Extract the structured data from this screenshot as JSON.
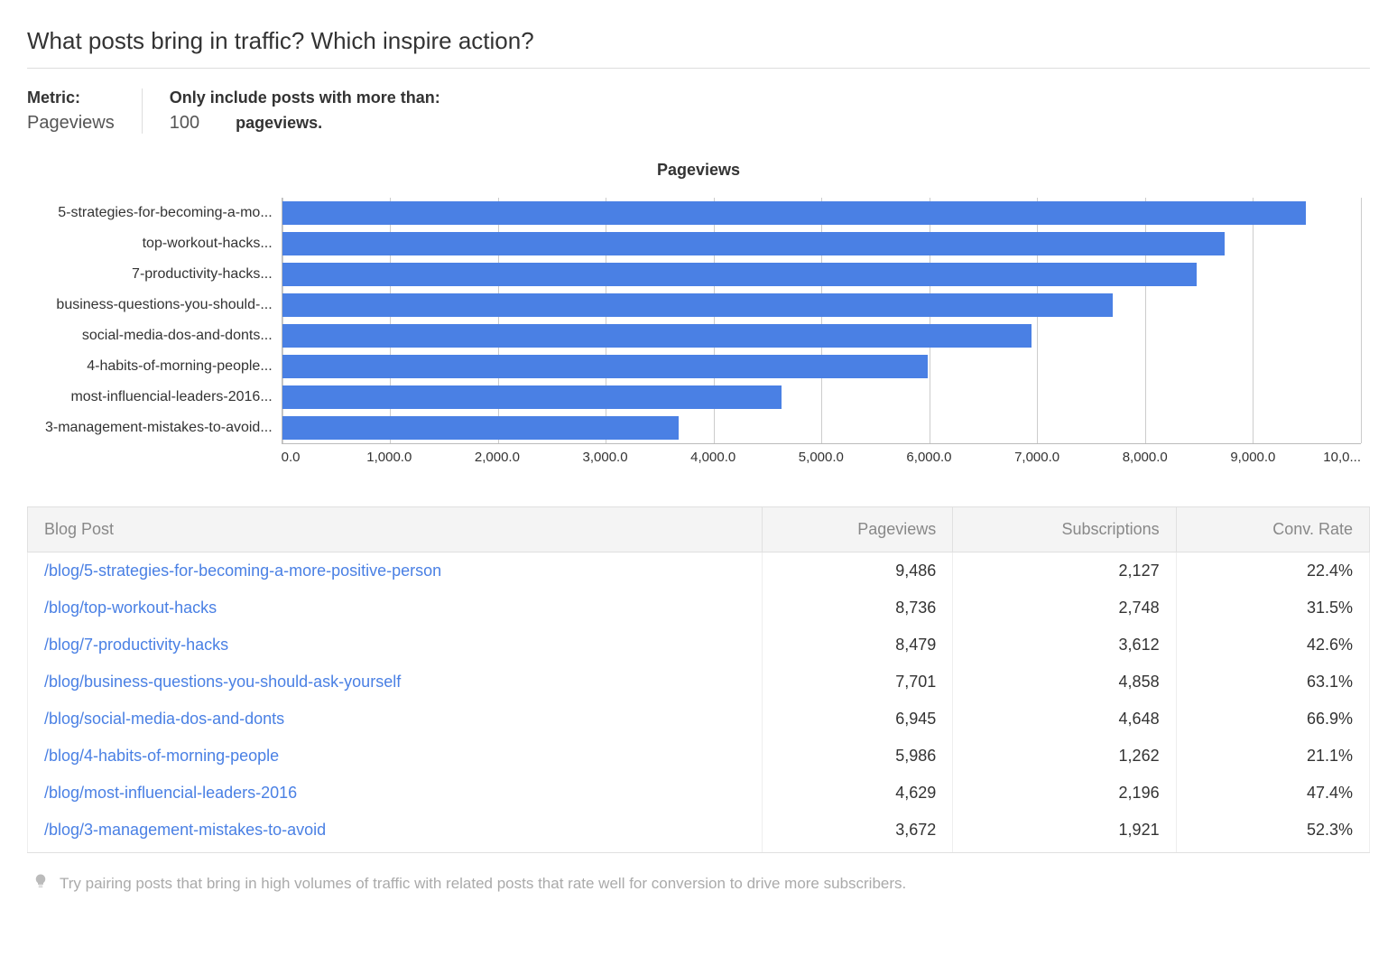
{
  "title": "What posts bring in traffic? Which inspire action?",
  "controls": {
    "metric_label": "Metric:",
    "metric_value": "Pageviews",
    "filter_label": "Only include posts with more than:",
    "filter_value": "100",
    "filter_suffix": "pageviews."
  },
  "chart_data": {
    "type": "bar",
    "orientation": "horizontal",
    "title": "Pageviews",
    "xlabel": "",
    "ylabel": "",
    "xlim": [
      0,
      10000
    ],
    "x_ticks": [
      "0.0",
      "1,000.0",
      "2,000.0",
      "3,000.0",
      "4,000.0",
      "5,000.0",
      "6,000.0",
      "7,000.0",
      "8,000.0",
      "9,000.0",
      "10,0..."
    ],
    "categories": [
      "5-strategies-for-becoming-a-mo...",
      "top-workout-hacks...",
      "7-productivity-hacks...",
      "business-questions-you-should-...",
      "social-media-dos-and-donts...",
      "4-habits-of-morning-people...",
      "most-influencial-leaders-2016...",
      "3-management-mistakes-to-avoid..."
    ],
    "values": [
      9486,
      8736,
      8479,
      7701,
      6945,
      5986,
      4629,
      3672
    ]
  },
  "table": {
    "columns": [
      "Blog Post",
      "Pageviews",
      "Subscriptions",
      "Conv. Rate"
    ],
    "rows": [
      {
        "post": "/blog/5-strategies-for-becoming-a-more-positive-person",
        "pageviews": "9,486",
        "subscriptions": "2,127",
        "conv": "22.4%"
      },
      {
        "post": "/blog/top-workout-hacks",
        "pageviews": "8,736",
        "subscriptions": "2,748",
        "conv": "31.5%"
      },
      {
        "post": "/blog/7-productivity-hacks",
        "pageviews": "8,479",
        "subscriptions": "3,612",
        "conv": "42.6%"
      },
      {
        "post": "/blog/business-questions-you-should-ask-yourself",
        "pageviews": "7,701",
        "subscriptions": "4,858",
        "conv": "63.1%"
      },
      {
        "post": "/blog/social-media-dos-and-donts",
        "pageviews": "6,945",
        "subscriptions": "4,648",
        "conv": "66.9%"
      },
      {
        "post": "/blog/4-habits-of-morning-people",
        "pageviews": "5,986",
        "subscriptions": "1,262",
        "conv": "21.1%"
      },
      {
        "post": "/blog/most-influencial-leaders-2016",
        "pageviews": "4,629",
        "subscriptions": "2,196",
        "conv": "47.4%"
      },
      {
        "post": "/blog/3-management-mistakes-to-avoid",
        "pageviews": "3,672",
        "subscriptions": "1,921",
        "conv": "52.3%"
      }
    ]
  },
  "tip": "Try pairing posts that bring in high volumes of traffic with related posts that rate well for conversion to drive more subscribers."
}
